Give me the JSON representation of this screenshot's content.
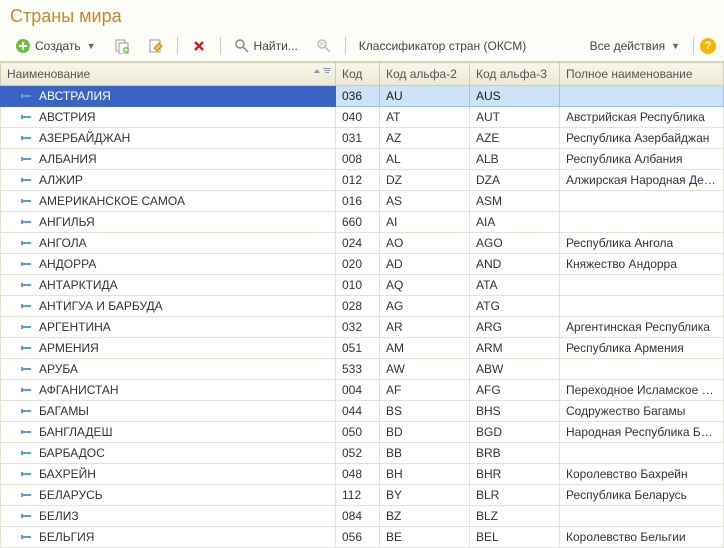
{
  "title": "Страны мира",
  "toolbar": {
    "create": "Создать",
    "find": "Найти...",
    "classifier": "Классификатор стран (ОКСМ)",
    "all_actions": "Все действия"
  },
  "columns": {
    "name": "Наименование",
    "code": "Код",
    "alpha2": "Код альфа-2",
    "alpha3": "Код альфа-3",
    "full": "Полное наименование"
  },
  "rows": [
    {
      "name": "АВСТРАЛИЯ",
      "code": "036",
      "a2": "AU",
      "a3": "AUS",
      "full": "",
      "selected": true
    },
    {
      "name": "АВСТРИЯ",
      "code": "040",
      "a2": "AT",
      "a3": "AUT",
      "full": "Австрийская Республика"
    },
    {
      "name": "АЗЕРБАЙДЖАН",
      "code": "031",
      "a2": "AZ",
      "a3": "AZE",
      "full": "Республика Азербайджан"
    },
    {
      "name": "АЛБАНИЯ",
      "code": "008",
      "a2": "AL",
      "a3": "ALB",
      "full": "Республика Албания"
    },
    {
      "name": "АЛЖИР",
      "code": "012",
      "a2": "DZ",
      "a3": "DZA",
      "full": "Алжирская Народная Демократич"
    },
    {
      "name": "АМЕРИКАНСКОЕ САМОА",
      "code": "016",
      "a2": "AS",
      "a3": "ASM",
      "full": ""
    },
    {
      "name": "АНГИЛЬЯ",
      "code": "660",
      "a2": "AI",
      "a3": "AIA",
      "full": ""
    },
    {
      "name": "АНГОЛА",
      "code": "024",
      "a2": "AO",
      "a3": "AGO",
      "full": "Республика Ангола"
    },
    {
      "name": "АНДОРРА",
      "code": "020",
      "a2": "AD",
      "a3": "AND",
      "full": "Княжество Андорра"
    },
    {
      "name": "АНТАРКТИДА",
      "code": "010",
      "a2": "AQ",
      "a3": "ATA",
      "full": ""
    },
    {
      "name": "АНТИГУА И БАРБУДА",
      "code": "028",
      "a2": "AG",
      "a3": "ATG",
      "full": ""
    },
    {
      "name": "АРГЕНТИНА",
      "code": "032",
      "a2": "AR",
      "a3": "ARG",
      "full": "Аргентинская Республика"
    },
    {
      "name": "АРМЕНИЯ",
      "code": "051",
      "a2": "AM",
      "a3": "ARM",
      "full": "Республика Армения"
    },
    {
      "name": "АРУБА",
      "code": "533",
      "a2": "AW",
      "a3": "ABW",
      "full": ""
    },
    {
      "name": "АФГАНИСТАН",
      "code": "004",
      "a2": "AF",
      "a3": "AFG",
      "full": "Переходное Исламское Государст"
    },
    {
      "name": "БАГАМЫ",
      "code": "044",
      "a2": "BS",
      "a3": "BHS",
      "full": "Содружество Багамы"
    },
    {
      "name": "БАНГЛАДЕШ",
      "code": "050",
      "a2": "BD",
      "a3": "BGD",
      "full": "Народная Республика Бангладеш"
    },
    {
      "name": "БАРБАДОС",
      "code": "052",
      "a2": "BB",
      "a3": "BRB",
      "full": ""
    },
    {
      "name": "БАХРЕЙН",
      "code": "048",
      "a2": "BH",
      "a3": "BHR",
      "full": "Королевство Бахрейн"
    },
    {
      "name": "БЕЛАРУСЬ",
      "code": "112",
      "a2": "BY",
      "a3": "BLR",
      "full": "Республика Беларусь"
    },
    {
      "name": "БЕЛИЗ",
      "code": "084",
      "a2": "BZ",
      "a3": "BLZ",
      "full": ""
    },
    {
      "name": "БЕЛЬГИЯ",
      "code": "056",
      "a2": "BE",
      "a3": "BEL",
      "full": "Королевство Бельгии"
    }
  ]
}
